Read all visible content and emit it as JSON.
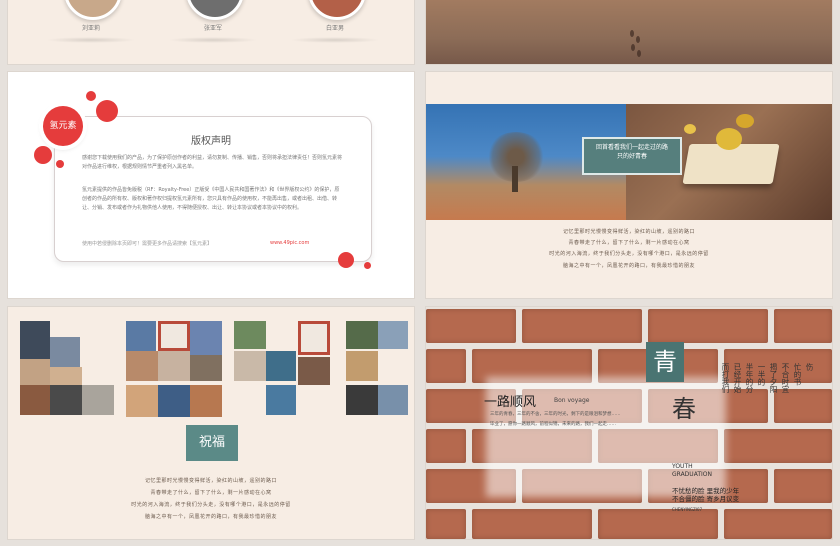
{
  "slide1": {
    "labels": [
      "刘亚莉",
      "张亚军",
      "白亚男"
    ]
  },
  "slide3": {
    "badge": "氢元素",
    "title": "版权声明",
    "para1": "感谢您下载使用我们的产品，为了保护原创作者的利益，请勿复制、传播、销售，否则将承担法律责任！否则氢元素将对作品进行维权，根据规则情节严重者列入黑名单。",
    "para2": "氢元素提供的作品皆免版税（RF：Royalty-Free）正版受《中国人民共和国著作法》和《世界版权公约》的保护，原创者的作品的所有权、版权和著作权归提权氢元素所有，您只具有作品的使用权，不能再出售，或者出租、出借、转让、分销、发布或者作为礼物供他人使用，不得随便授权、出让、转让本协议或者本协议中的权利。",
    "footer_left": "使用中若侵删除本页即可！需要更多作品请搜索【氢元素】",
    "footer_right": "www.49pic.com"
  },
  "slide4": {
    "label": "回首看看我们一起走过的路\n只的好青春",
    "poem": [
      "记忆里那时光慢慢变得鲜活，染红的山坡，遥别的路口",
      "青春带走了什么，留下了什么，剩一片感动在心窝",
      "时光的河入海流，终于我们分头走，没有哪个港口，是永远的停留",
      "脑海之中有一个，凤凰花开的路口，有我最珍惜的朋友"
    ]
  },
  "slide5": {
    "stamp": "祝福",
    "poem": [
      "记忆里那时光慢慢变得鲜活，染红的山坡，遥别的路口",
      "青春带走了什么，留下了什么，剩一片感动在心窝",
      "时光的河入海流，终于我们分头走，没有哪个港口，是永远的停留",
      "脑海之中有一个，凤凰花开的路口，有我最珍惜的朋友"
    ]
  },
  "slide6": {
    "qing": "青",
    "chun": "春",
    "heading": "一路顺风",
    "bon_voyage": "Bon voyage",
    "small": [
      "三年的青春，三年的不舍，三年的时光，剩下的是眼泪和梦想……",
      "毕业了，愿你一路顺风，前程似锦，未来的路，我们一起走……"
    ],
    "vertical_cols": [
      "而打我们",
      "已经开始",
      "半年的分",
      "一半的",
      "揭了夕阳",
      "不合时宜",
      "忙的书",
      "伤"
    ],
    "youth": "YOUTH",
    "graduation": "GRADUATION",
    "cap1": "不忧愁的脸 里我的少年",
    "cap2": "不合僵的脸 寄乡月议变",
    "tiny": "CHENYINGZI07"
  }
}
